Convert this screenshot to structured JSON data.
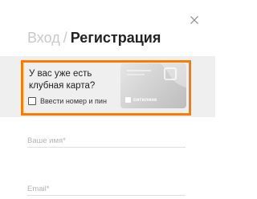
{
  "header": {
    "login_tab": "Вход",
    "separator": "/",
    "register_tab": "Регистрация"
  },
  "close": {
    "icon": "close-icon"
  },
  "promo": {
    "question": "У вас уже есть клубная карта?",
    "checkbox_label": "Ввести номер и пин",
    "checkbox_checked": false,
    "card_brand": "ситилинк",
    "highlight_color": "#ff7a00",
    "background_color": "#efefef"
  },
  "form": {
    "name_field": {
      "value": "",
      "placeholder": "Ваше имя*"
    },
    "email_field": {
      "value": "",
      "placeholder": "Email*"
    }
  },
  "colors": {
    "active_tab": "#222222",
    "inactive_tab": "#c9c9c9"
  }
}
